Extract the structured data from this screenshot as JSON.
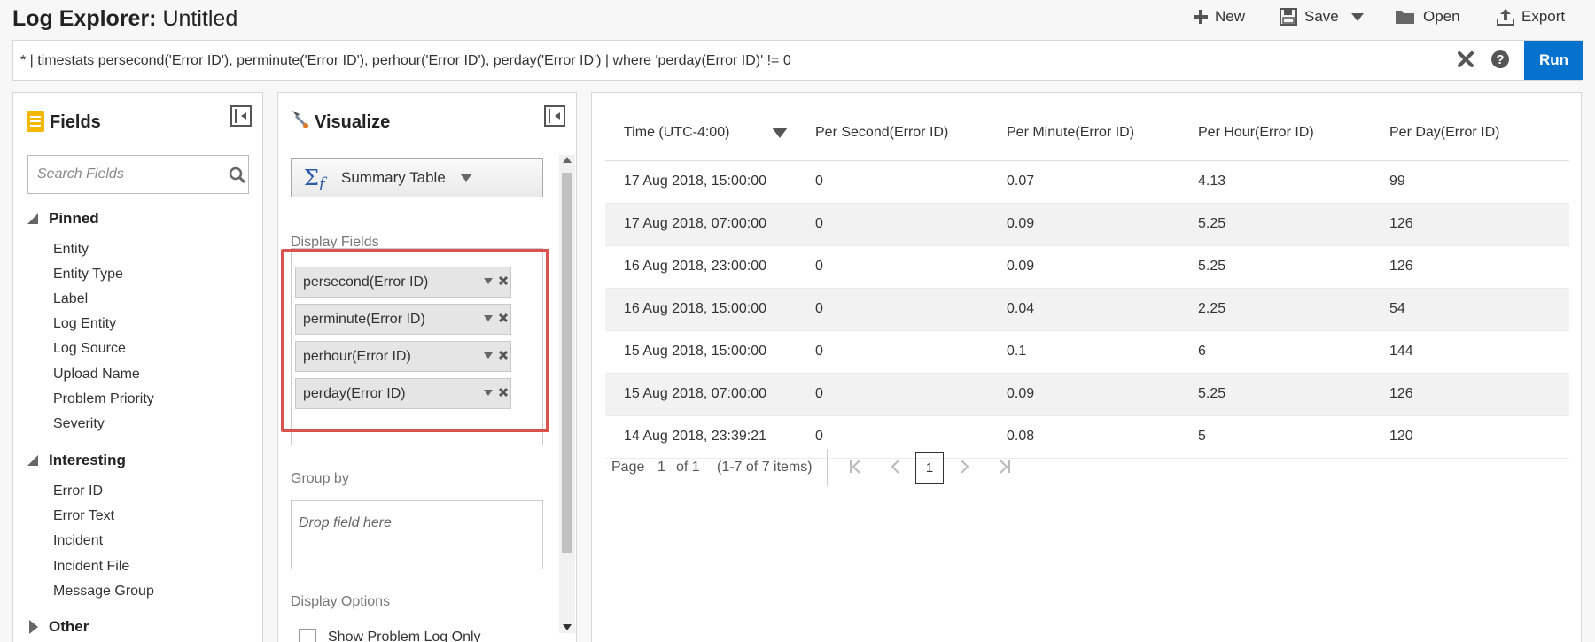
{
  "header": {
    "title_bold": "Log Explorer:",
    "title_rest": "Untitled",
    "toolbar": {
      "new": "New",
      "save": "Save",
      "open": "Open",
      "export": "Export"
    }
  },
  "query": {
    "text": "* | timestats persecond('Error ID'), perminute('Error ID'), perhour('Error ID'), perday('Error ID') | where 'perday(Error ID)' != 0",
    "run_label": "Run"
  },
  "fields_panel": {
    "title": "Fields",
    "search_placeholder": "Search Fields",
    "pinned_label": "Pinned",
    "pinned": [
      "Entity",
      "Entity Type",
      "Label",
      "Log Entity",
      "Log Source",
      "Upload Name",
      "Problem Priority",
      "Severity"
    ],
    "interesting_label": "Interesting",
    "interesting": [
      "Error ID",
      "Error Text",
      "Incident",
      "Incident File",
      "Message Group"
    ],
    "other_label": "Other"
  },
  "viz_panel": {
    "title": "Visualize",
    "viz_type": "Summary Table",
    "display_fields_label": "Display Fields",
    "display_fields": [
      "persecond(Error ID)",
      "perminute(Error ID)",
      "perhour(Error ID)",
      "perday(Error ID)"
    ],
    "group_by_label": "Group by",
    "drop_placeholder": "Drop field here",
    "display_options_label": "Display Options",
    "option_partial": "Show Problem Log Only"
  },
  "results": {
    "columns": [
      "Time (UTC-4:00)",
      "Per Second(Error ID)",
      "Per Minute(Error ID)",
      "Per Hour(Error ID)",
      "Per Day(Error ID)"
    ],
    "rows": [
      [
        "17 Aug 2018, 15:00:00",
        "0",
        "0.07",
        "4.13",
        "99"
      ],
      [
        "17 Aug 2018, 07:00:00",
        "0",
        "0.09",
        "5.25",
        "126"
      ],
      [
        "16 Aug 2018, 23:00:00",
        "0",
        "0.09",
        "5.25",
        "126"
      ],
      [
        "16 Aug 2018, 15:00:00",
        "0",
        "0.04",
        "2.25",
        "54"
      ],
      [
        "15 Aug 2018, 15:00:00",
        "0",
        "0.1",
        "6",
        "144"
      ],
      [
        "15 Aug 2018, 07:00:00",
        "0",
        "0.09",
        "5.25",
        "126"
      ],
      [
        "14 Aug 2018, 23:39:21",
        "0",
        "0.08",
        "5",
        "120"
      ]
    ],
    "pagination": {
      "page_label": "Page",
      "page": "1",
      "of_label": "of 1",
      "items": "(1-7 of 7 items)",
      "current": "1"
    }
  },
  "colors": {
    "accent": "#0572ce",
    "highlight": "#d9534f",
    "row_alt": "#f2f2f2"
  }
}
